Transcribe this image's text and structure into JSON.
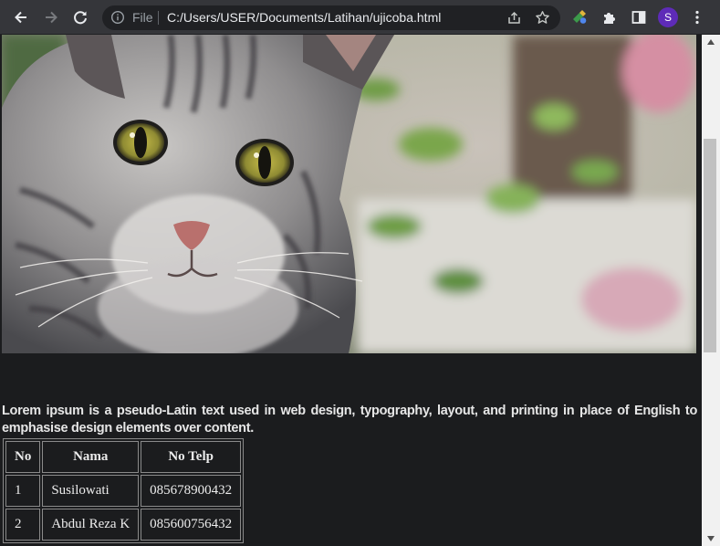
{
  "browser": {
    "address_prefix": "File",
    "url": "C:/Users/USER/Documents/Latihan/ujicoba.html",
    "profile_initial": "S"
  },
  "page": {
    "image_subject": "cat-photo",
    "paragraph": "Lorem ipsum is a pseudo-Latin text used in web design, typography, layout, and printing in place of English to emphasise design elements over content.",
    "table": {
      "headers": [
        "No",
        "Nama",
        "No Telp"
      ],
      "rows": [
        [
          "1",
          "Susilowati",
          "085678900432"
        ],
        [
          "2",
          "Abdul Reza K",
          "085600756432"
        ]
      ]
    }
  },
  "scrollbar": {
    "position_fraction": 0.2
  },
  "colors": {
    "toolbar_bg": "#35363a",
    "omnibox_bg": "#202124",
    "page_bg": "#1b1c1e",
    "avatar_bg": "#5e2bb8",
    "text": "#e6e6e6"
  }
}
